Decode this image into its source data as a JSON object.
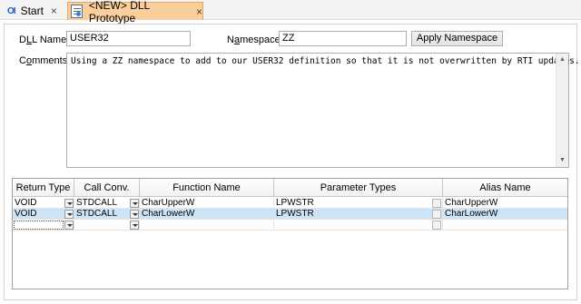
{
  "tabs": [
    {
      "label": "Start",
      "icon": "app-logo-icon",
      "close": "×"
    },
    {
      "label": "<NEW> DLL Prototype",
      "icon": "document-icon",
      "close": "×",
      "active": true
    }
  ],
  "colors": {
    "active_tab": "#fbcf9d",
    "selected_row": "#cce4f7"
  },
  "form": {
    "dll_name_label_pre": "D",
    "dll_name_label_u": "L",
    "dll_name_label_post": "L Name:",
    "dll_name_value": "USER32",
    "namespace_label_pre": "N",
    "namespace_label_u": "a",
    "namespace_label_post": "mespace:",
    "namespace_value": "ZZ",
    "apply_button": "Apply Namespace",
    "comments_label_pre": "C",
    "comments_label_u": "o",
    "comments_label_post": "mments:",
    "comments_value": "Using a ZZ namespace to add to our USER32 definition so that it is not overwritten by RTI updates."
  },
  "grid": {
    "columns": [
      "Return Type",
      "Call Conv.",
      "Function Name",
      "Parameter Types",
      "Alias Name"
    ],
    "rows": [
      {
        "return_type": "VOID",
        "call_conv": "STDCALL",
        "function_name": "CharUpperW",
        "parameter_types": "LPWSTR",
        "alias_name": "CharUpperW",
        "selected": false
      },
      {
        "return_type": "VOID",
        "call_conv": "STDCALL",
        "function_name": "CharLowerW",
        "parameter_types": "LPWSTR",
        "alias_name": "CharLowerW",
        "selected": true
      },
      {
        "return_type": "",
        "call_conv": "",
        "function_name": "",
        "parameter_types": "",
        "alias_name": "",
        "selected": false
      }
    ]
  }
}
